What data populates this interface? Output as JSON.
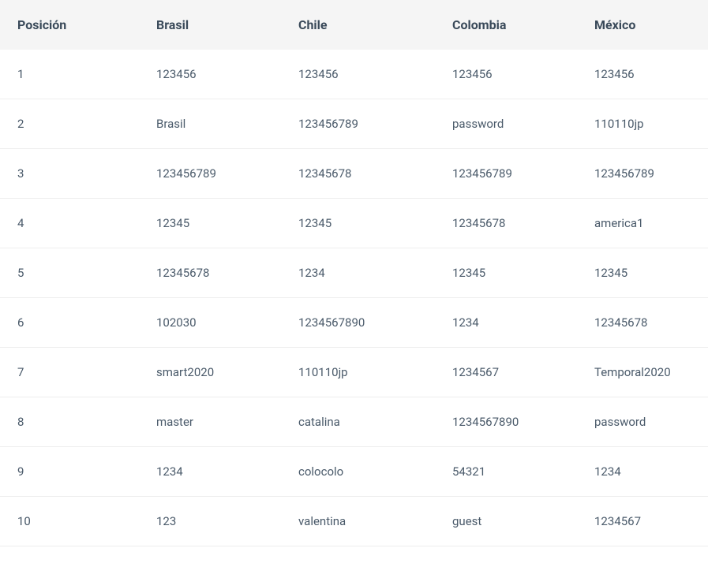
{
  "table": {
    "headers": [
      "Posición",
      "Brasil",
      "Chile",
      "Colombia",
      "México"
    ],
    "rows": [
      [
        "1",
        "123456",
        "123456",
        "123456",
        "123456"
      ],
      [
        "2",
        "Brasil",
        "123456789",
        "password",
        "110110jp"
      ],
      [
        "3",
        "123456789",
        "12345678",
        "123456789",
        "123456789"
      ],
      [
        "4",
        "12345",
        "12345",
        "12345678",
        "america1"
      ],
      [
        "5",
        "12345678",
        "1234",
        "12345",
        "12345"
      ],
      [
        "6",
        "102030",
        "1234567890",
        "1234",
        "12345678"
      ],
      [
        "7",
        "smart2020",
        "110110jp",
        "1234567",
        "Temporal2020"
      ],
      [
        "8",
        "master",
        "catalina",
        "1234567890",
        "password"
      ],
      [
        "9",
        "1234",
        "colocolo",
        "54321",
        "1234"
      ],
      [
        "10",
        "123",
        "valentina",
        "guest",
        "1234567"
      ]
    ]
  }
}
